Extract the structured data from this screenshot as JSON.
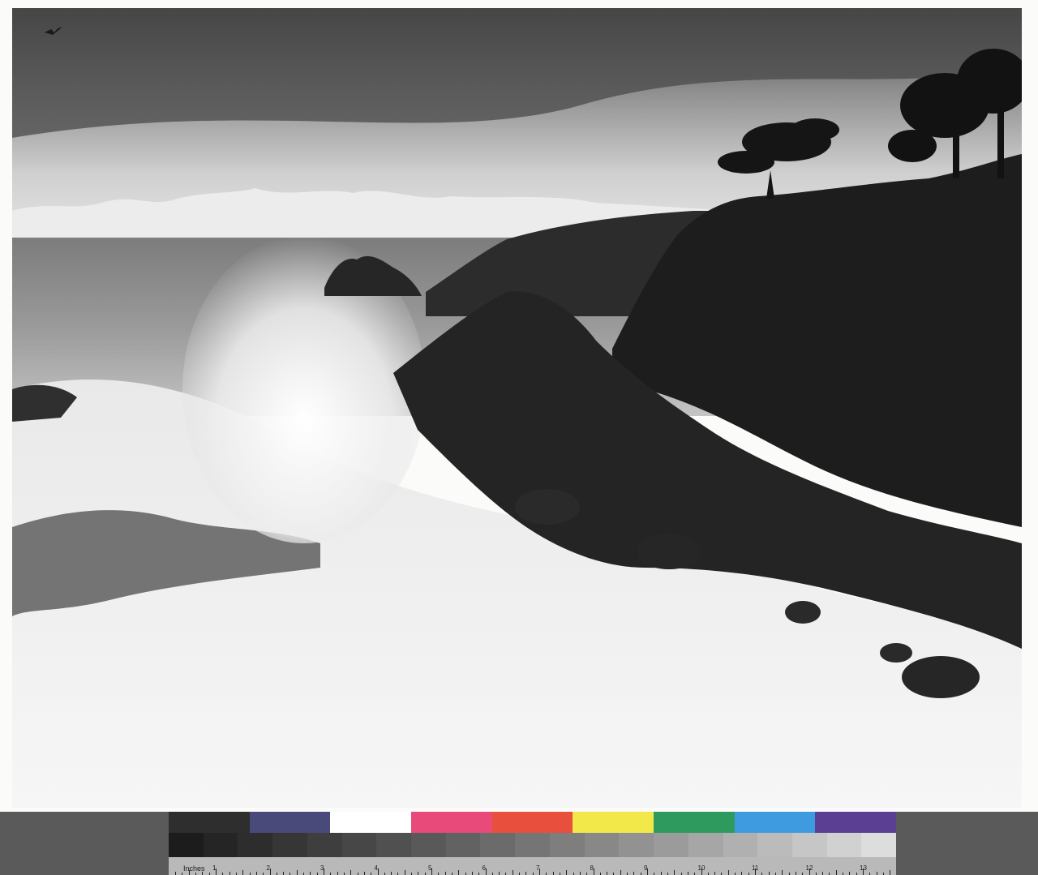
{
  "photograph": {
    "subject": "coastal-cliffs-crashing-wave",
    "palette": "black-and-white"
  },
  "color_target": {
    "top_row_colors": [
      "#2e2e2e",
      "#4a4a7a",
      "#ffffff",
      "#e84a7a",
      "#e84f3d",
      "#f3e84a",
      "#2f9a5e",
      "#3f9be0",
      "#5a3f92"
    ],
    "gray_ramp": [
      "#1c1c1c",
      "#252525",
      "#2d2d2d",
      "#363636",
      "#3e3e3e",
      "#474747",
      "#505050",
      "#595959",
      "#626262",
      "#6b6b6b",
      "#757575",
      "#7e7e7e",
      "#888888",
      "#929292",
      "#9b9b9b",
      "#a6a6a6",
      "#b0b0b0",
      "#bbbbbb",
      "#c6c6c6",
      "#d1d1d1",
      "#dddddd"
    ]
  },
  "ruler": {
    "label": "Inches",
    "numbers": [
      "1",
      "2",
      "3",
      "4",
      "5",
      "6",
      "7",
      "8",
      "9",
      "10",
      "11",
      "12",
      "13"
    ]
  }
}
